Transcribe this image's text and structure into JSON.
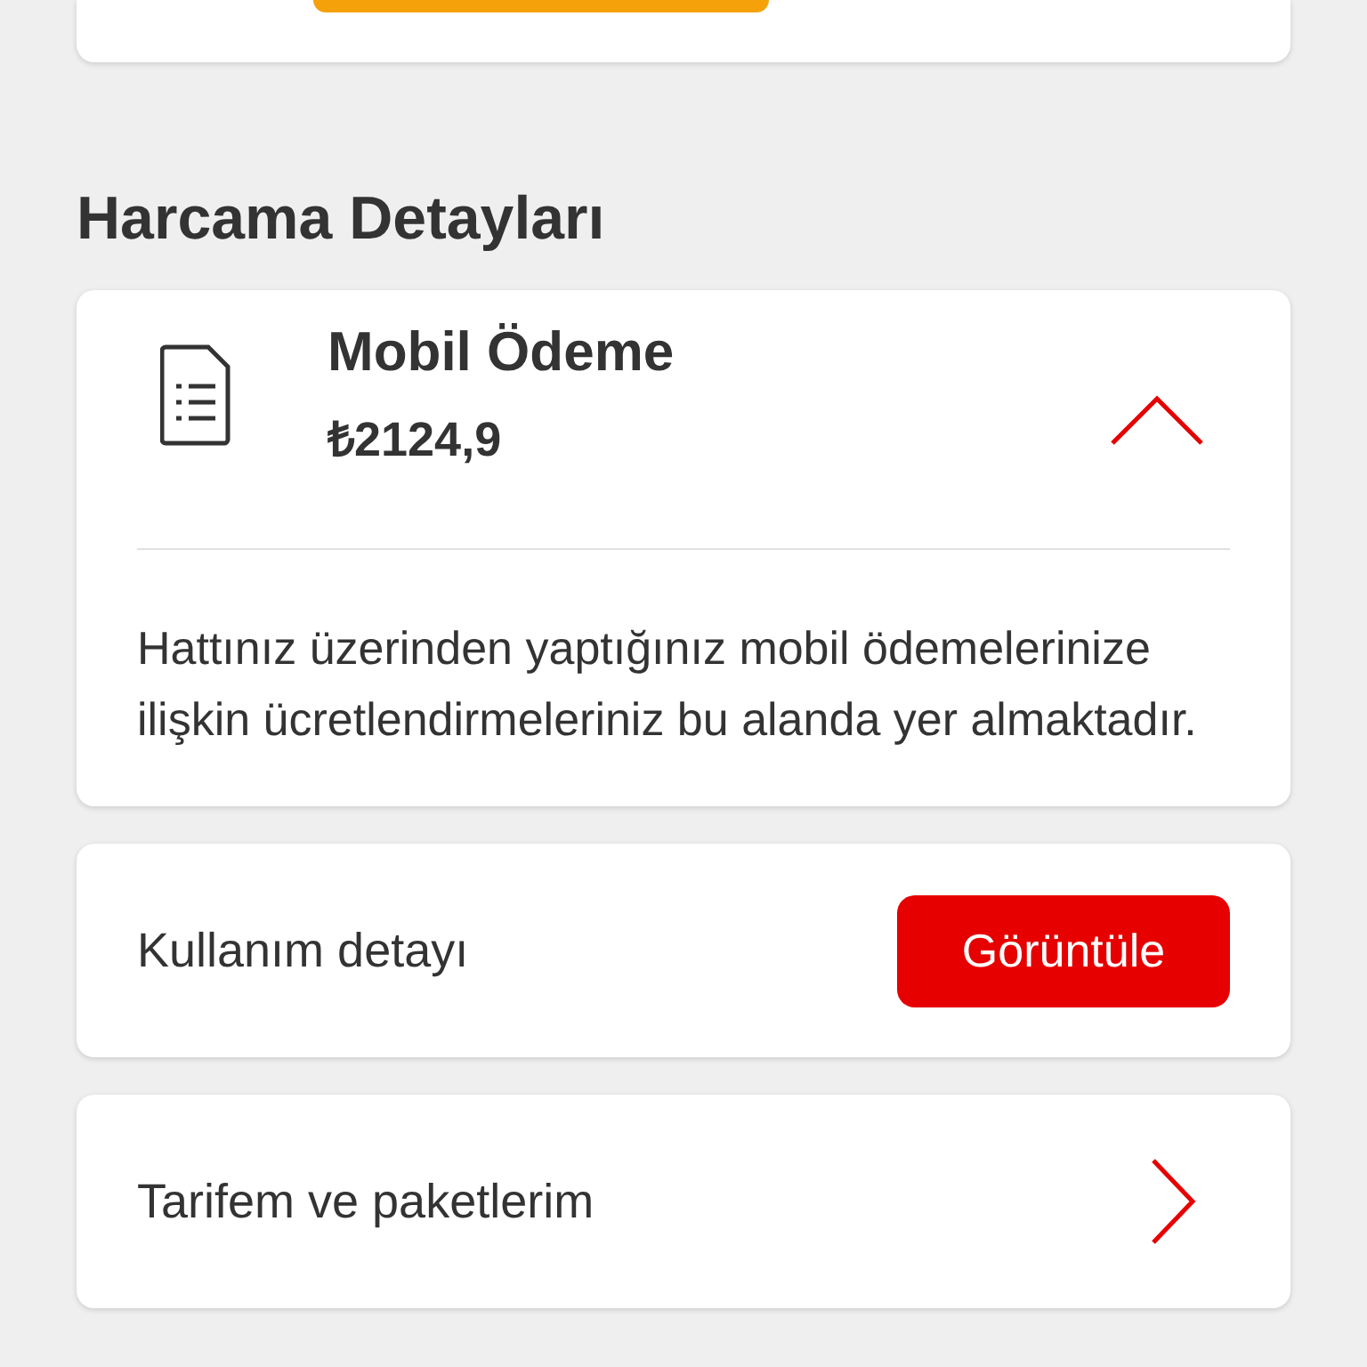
{
  "section_title": "Harcama Detayları",
  "expense_card": {
    "title": "Mobil Ödeme",
    "amount": "₺2124,9",
    "expanded": true,
    "description": "Hattınız üzerinden yaptığınız mobil ödemelerinize ilişkin ücretlendirmeleriniz bu alanda yer almaktadır."
  },
  "rows": [
    {
      "kind": "button",
      "label": "Kullanım detayı",
      "button": "Görüntüle"
    },
    {
      "kind": "link",
      "label": "Tarifem ve paketlerim"
    }
  ]
}
